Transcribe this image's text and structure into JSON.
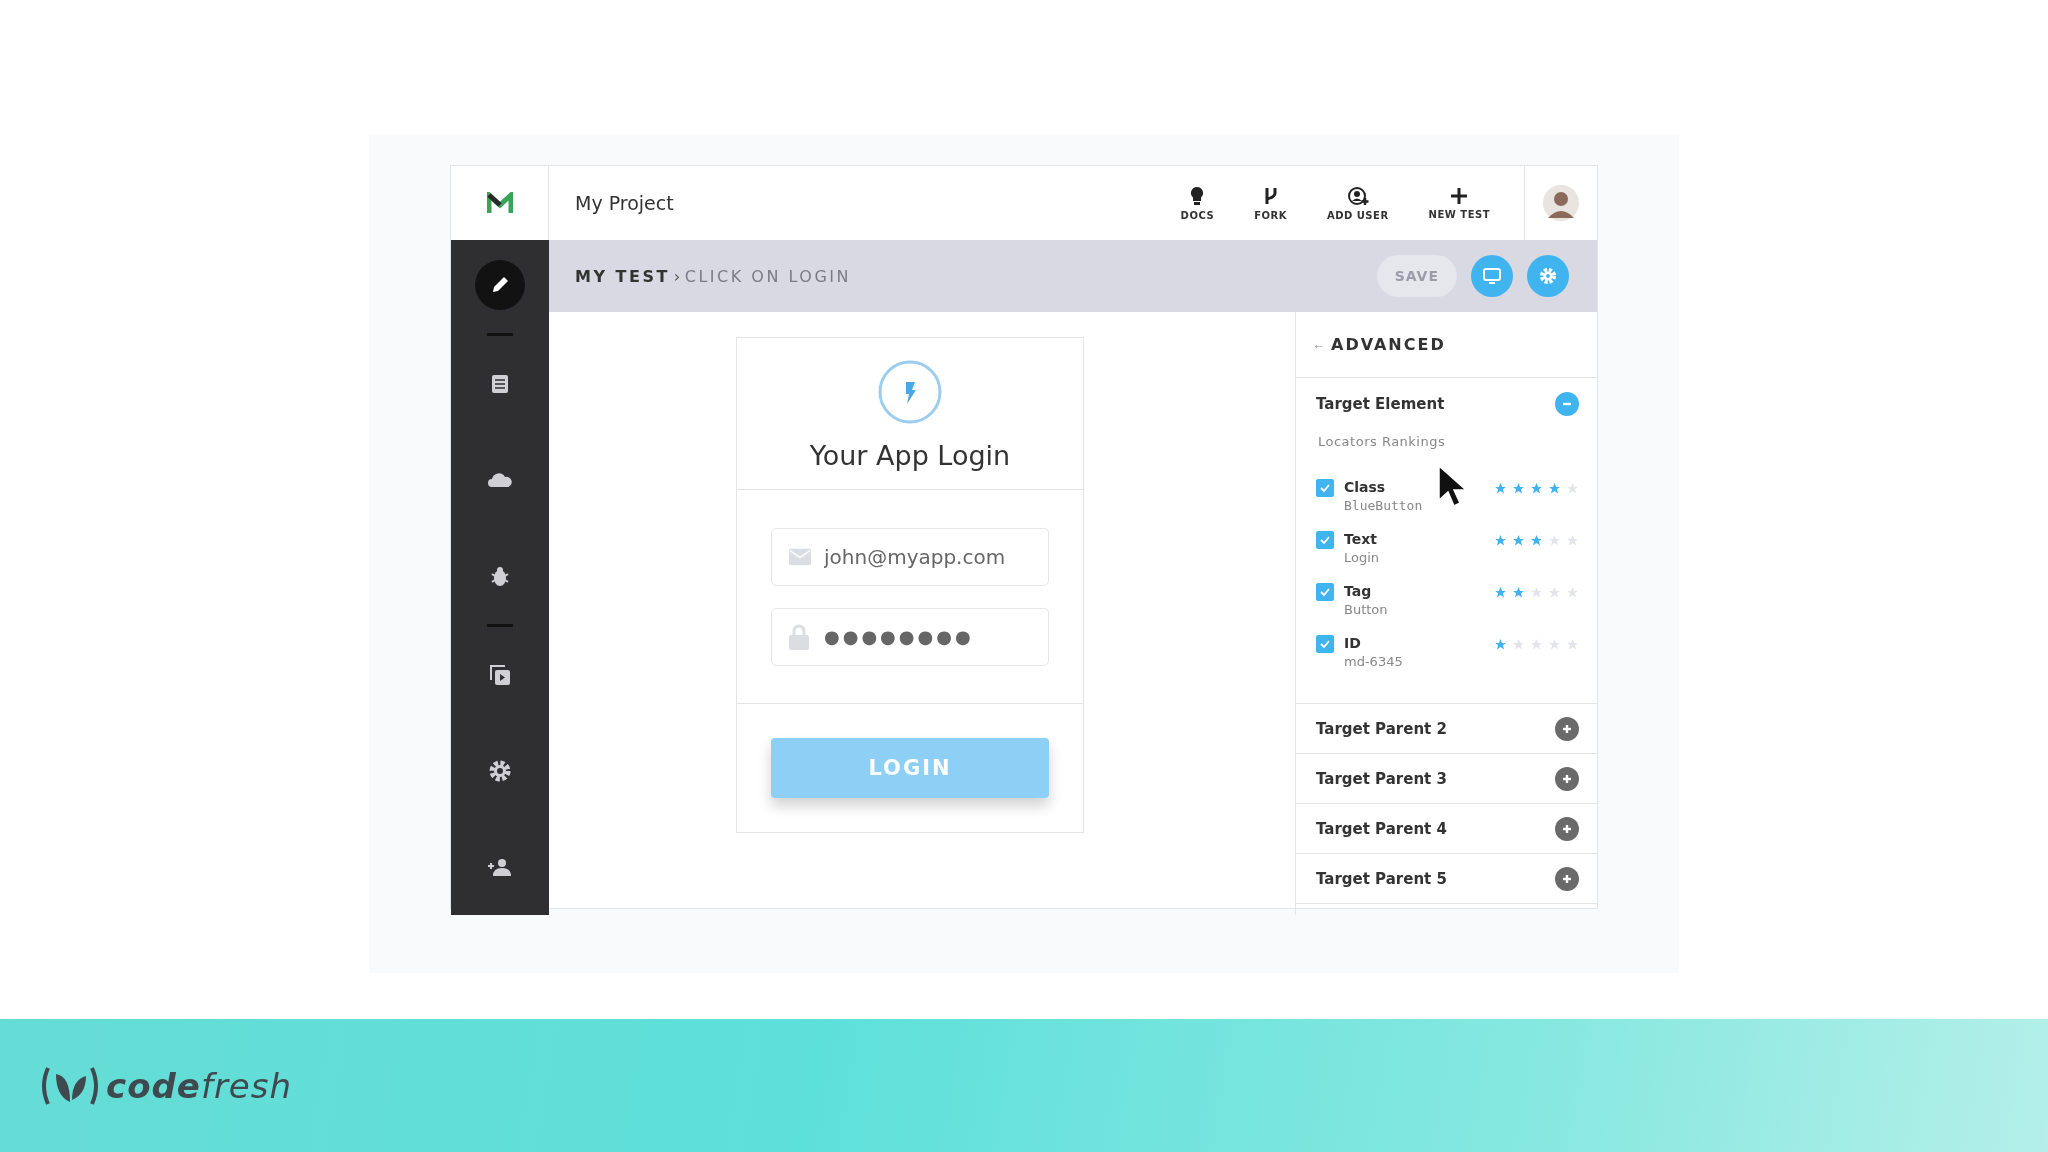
{
  "app": {
    "project_title": "My Project",
    "toolbar": [
      {
        "kind": "docs",
        "label": "DOCS"
      },
      {
        "kind": "fork",
        "label": "FORK"
      },
      {
        "kind": "add_user",
        "label": "ADD USER"
      },
      {
        "kind": "new_test",
        "label": "NEW TEST"
      }
    ],
    "sidebar": {
      "items": [
        {
          "kind": "edit",
          "selected": true
        },
        {
          "kind": "divider"
        },
        {
          "kind": "list",
          "selected": false
        },
        {
          "kind": "cloud",
          "selected": false
        },
        {
          "kind": "bug",
          "selected": false
        },
        {
          "kind": "divider"
        },
        {
          "kind": "media",
          "selected": false
        },
        {
          "kind": "settings",
          "selected": false
        },
        {
          "kind": "users",
          "selected": false
        }
      ]
    },
    "breadcrumb": {
      "items": [
        "MY TEST",
        "CLICK ON LOGIN"
      ],
      "separator": "›"
    },
    "header_buttons": [
      {
        "kind": "save",
        "label": "SAVE",
        "disabled": true
      },
      {
        "kind": "monitor"
      },
      {
        "kind": "settings"
      }
    ],
    "login_card": {
      "title": "Your App Login",
      "email": "john@myapp.com",
      "password": "●●●●●●●●",
      "button": "LOGIN"
    },
    "advanced_panel": {
      "back": "←",
      "title": "ADVANCED",
      "sections": [
        {
          "title": "Target Element",
          "expanded": true,
          "subtitle": "Locators Rankings",
          "locators": [
            {
              "name": "Class",
              "value": "BlueButton",
              "checked": true,
              "stars": 4
            },
            {
              "name": "Text",
              "value": "Login",
              "checked": true,
              "stars": 3
            },
            {
              "name": "Tag",
              "value": "Button",
              "checked": true,
              "stars": 2
            },
            {
              "name": "ID",
              "value": "md-6345",
              "checked": true,
              "stars": 1
            }
          ]
        },
        {
          "title": "Target Parent 2",
          "expanded": false
        },
        {
          "title": "Target Parent 3",
          "expanded": false
        },
        {
          "title": "Target Parent 4",
          "expanded": false
        },
        {
          "title": "Target Parent 5",
          "expanded": false
        }
      ]
    }
  },
  "footer": {
    "logo": "**code**fresh"
  }
}
